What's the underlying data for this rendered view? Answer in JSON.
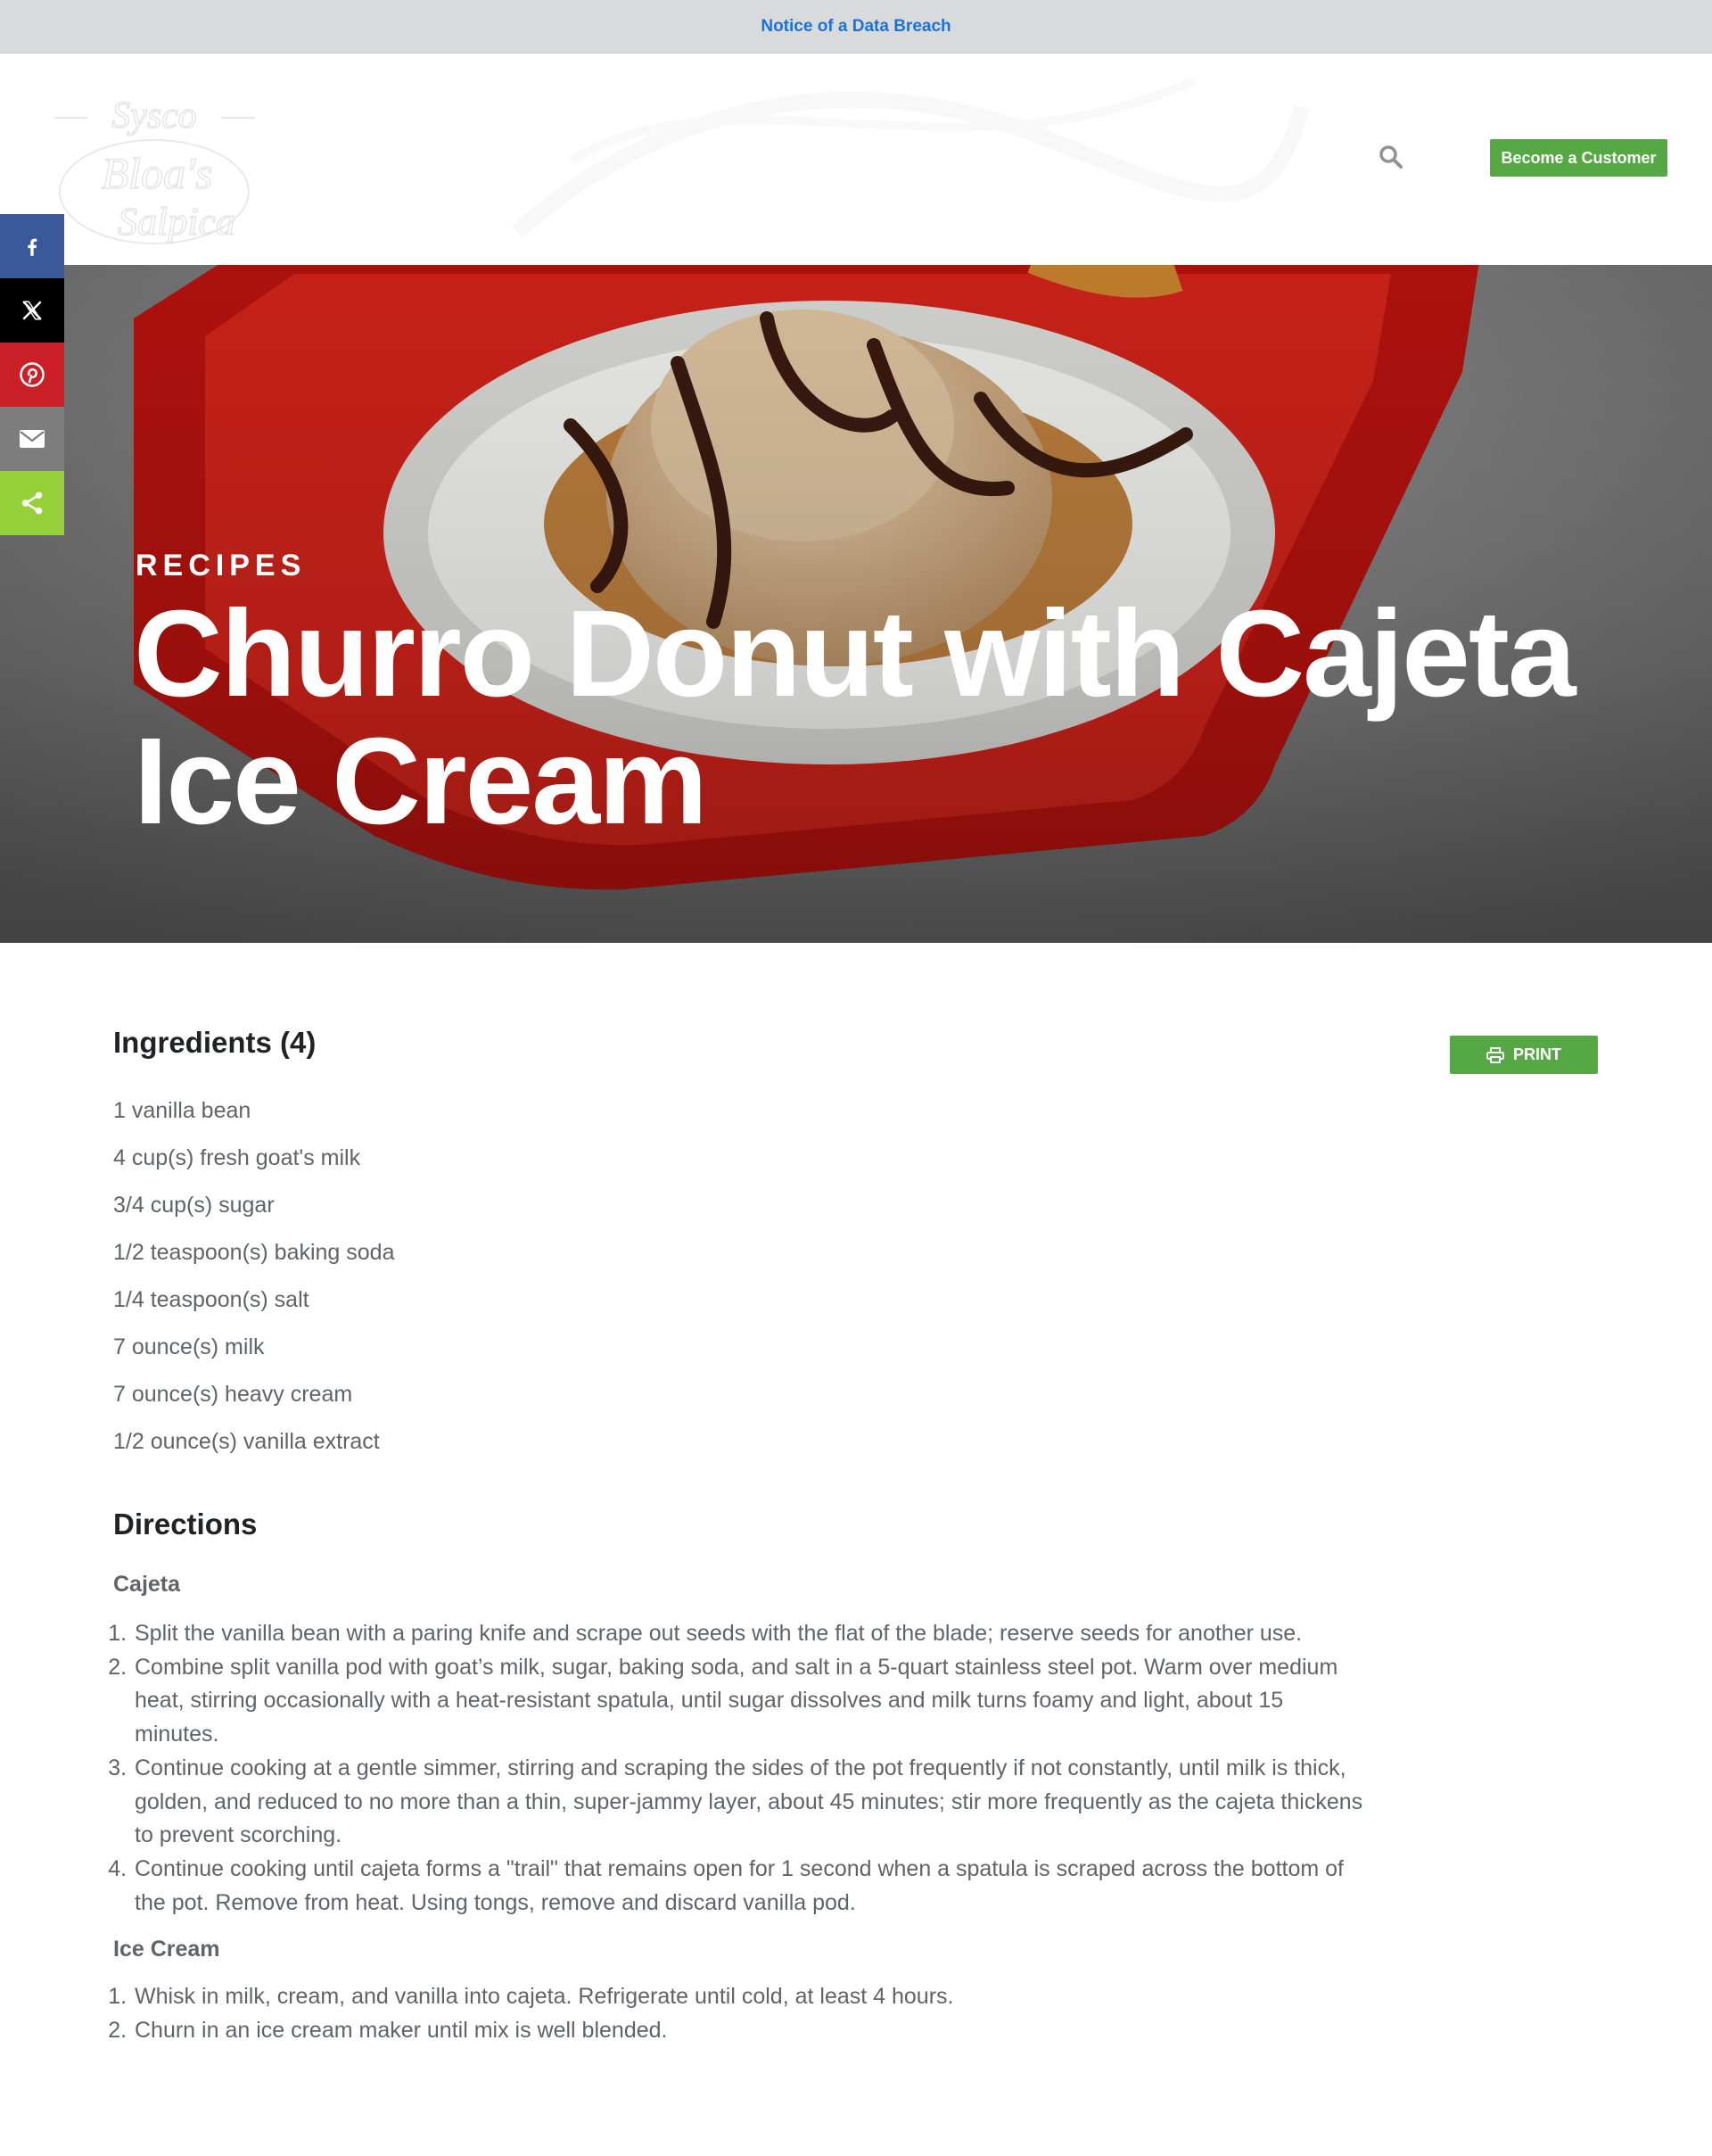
{
  "notice": {
    "link": "Notice of a Data Breach"
  },
  "header": {
    "logo_text": [
      "Sysco",
      "Bloa's",
      "Salpica"
    ],
    "cta": "Become a Customer",
    "search_icon": "search-icon"
  },
  "share": {
    "items": [
      {
        "name": "facebook",
        "icon": "facebook-icon",
        "color": "#3b5998"
      },
      {
        "name": "x",
        "icon": "x-icon",
        "color": "#000000"
      },
      {
        "name": "pinterest",
        "icon": "pinterest-icon",
        "color": "#cb2027"
      },
      {
        "name": "email",
        "icon": "email-icon",
        "color": "#7d7d7d"
      },
      {
        "name": "sharethis",
        "icon": "share-icon",
        "color": "#95d03a"
      }
    ]
  },
  "hero": {
    "kicker": "RECIPES",
    "title": "Churro Donut with Cajeta Ice Cream"
  },
  "recipe": {
    "ingredients_heading": "Ingredients (4)",
    "print_label": "PRINT",
    "ingredients": [
      "1 vanilla bean",
      "4 cup(s) fresh goat's milk",
      "3/4 cup(s) sugar",
      "1/2 teaspoon(s) baking soda",
      "1/4 teaspoon(s) salt",
      "7 ounce(s) milk",
      "7 ounce(s) heavy cream",
      "1/2 ounce(s) vanilla extract"
    ],
    "directions_heading": "Directions",
    "sections": [
      {
        "title": "Cajeta",
        "steps": [
          "Split the vanilla bean with a paring knife and scrape out seeds with the flat of the blade; reserve seeds for another use.",
          "Combine split vanilla pod with goat’s milk, sugar, baking soda, and salt in a 5-quart stainless steel pot. Warm over medium heat, stirring occasionally with a heat-resistant spatula, until sugar dissolves and milk turns foamy and light, about 15 minutes.",
          "Continue cooking at a gentle simmer, stirring and scraping the sides of the pot frequently if not constantly, until milk is thick, golden, and reduced to no more than a thin, super-jammy layer, about 45 minutes; stir more frequently as the cajeta thickens to prevent scorching.",
          "Continue cooking until cajeta forms a \"trail\" that remains open for 1 second when a spatula is scraped across the bottom of the pot. Remove from heat. Using tongs, remove and discard vanilla pod."
        ]
      },
      {
        "title": "Ice Cream",
        "steps": [
          "Whisk in milk, cream, and vanilla into cajeta. Refrigerate until cold, at least 4 hours.",
          "Churn in an ice cream maker until mix is well blended."
        ]
      }
    ]
  },
  "colors": {
    "brand_green": "#56a844",
    "notice_link": "#1a73d9",
    "notice_bg": "#d9dadc"
  }
}
